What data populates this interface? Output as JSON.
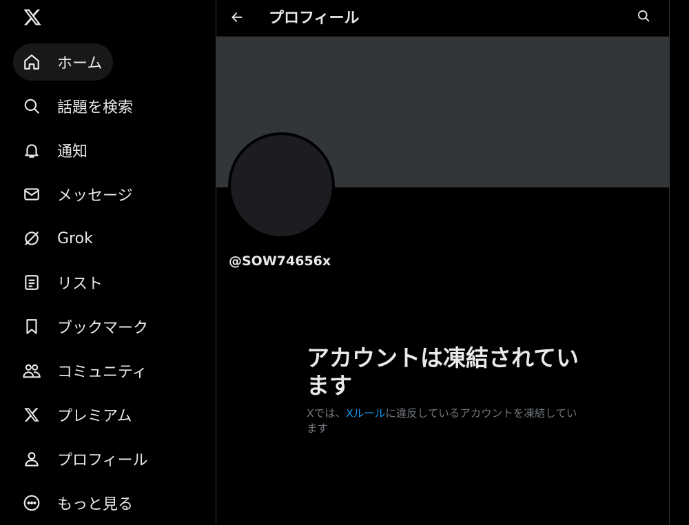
{
  "sidebar": {
    "logo": "x-logo-icon",
    "items": [
      {
        "label": "ホーム",
        "icon": "home-icon"
      },
      {
        "label": "話題を検索",
        "icon": "search-icon"
      },
      {
        "label": "通知",
        "icon": "bell-icon"
      },
      {
        "label": "メッセージ",
        "icon": "envelope-icon"
      },
      {
        "label": "Grok",
        "icon": "grok-icon"
      },
      {
        "label": "リスト",
        "icon": "list-icon"
      },
      {
        "label": "ブックマーク",
        "icon": "bookmark-icon"
      },
      {
        "label": "コミュニティ",
        "icon": "community-icon"
      },
      {
        "label": "プレミアム",
        "icon": "x-premium-icon"
      },
      {
        "label": "プロフィール",
        "icon": "person-icon"
      },
      {
        "label": "もっと見る",
        "icon": "more-circle-icon"
      }
    ]
  },
  "header": {
    "title": "プロフィール"
  },
  "profile": {
    "handle": "@SOW74656x"
  },
  "suspended": {
    "title": "アカウントは凍結されています",
    "desc_prefix": "Xでは、",
    "desc_link": "Xルール",
    "desc_suffix": "に違反しているアカウントを凍結しています"
  },
  "colors": {
    "background": "#000000",
    "banner": "#333639",
    "text": "#e7e9ea",
    "muted": "#71767b",
    "link": "#1d9bf0"
  }
}
